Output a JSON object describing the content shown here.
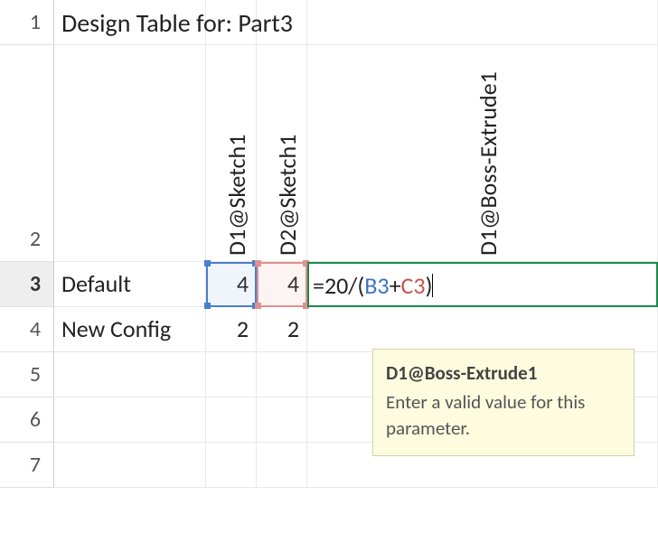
{
  "rows": [
    "1",
    "2",
    "3",
    "4",
    "5",
    "6",
    "7"
  ],
  "title": "Design Table for: Part3",
  "headers": {
    "col_b": "D1@Sketch1",
    "col_c": "D2@Sketch1",
    "col_d": "D1@Boss-Extrude1"
  },
  "data": {
    "r3": {
      "a": "Default",
      "b": "4",
      "c": "4"
    },
    "r4": {
      "a": "New Config",
      "b": "2",
      "c": "2"
    }
  },
  "formula": {
    "prefix": "=20/(",
    "ref1": "B3",
    "plus": "+",
    "ref2": "C3",
    "suffix": ")"
  },
  "tooltip": {
    "title": "D1@Boss-Extrude1",
    "body": "Enter a valid value for this parameter."
  },
  "colors": {
    "edit_border": "#1a8a4a",
    "ref_blue": "#3b72c4",
    "ref_red": "#c7554d",
    "tooltip_bg": "#fdfcdf"
  }
}
